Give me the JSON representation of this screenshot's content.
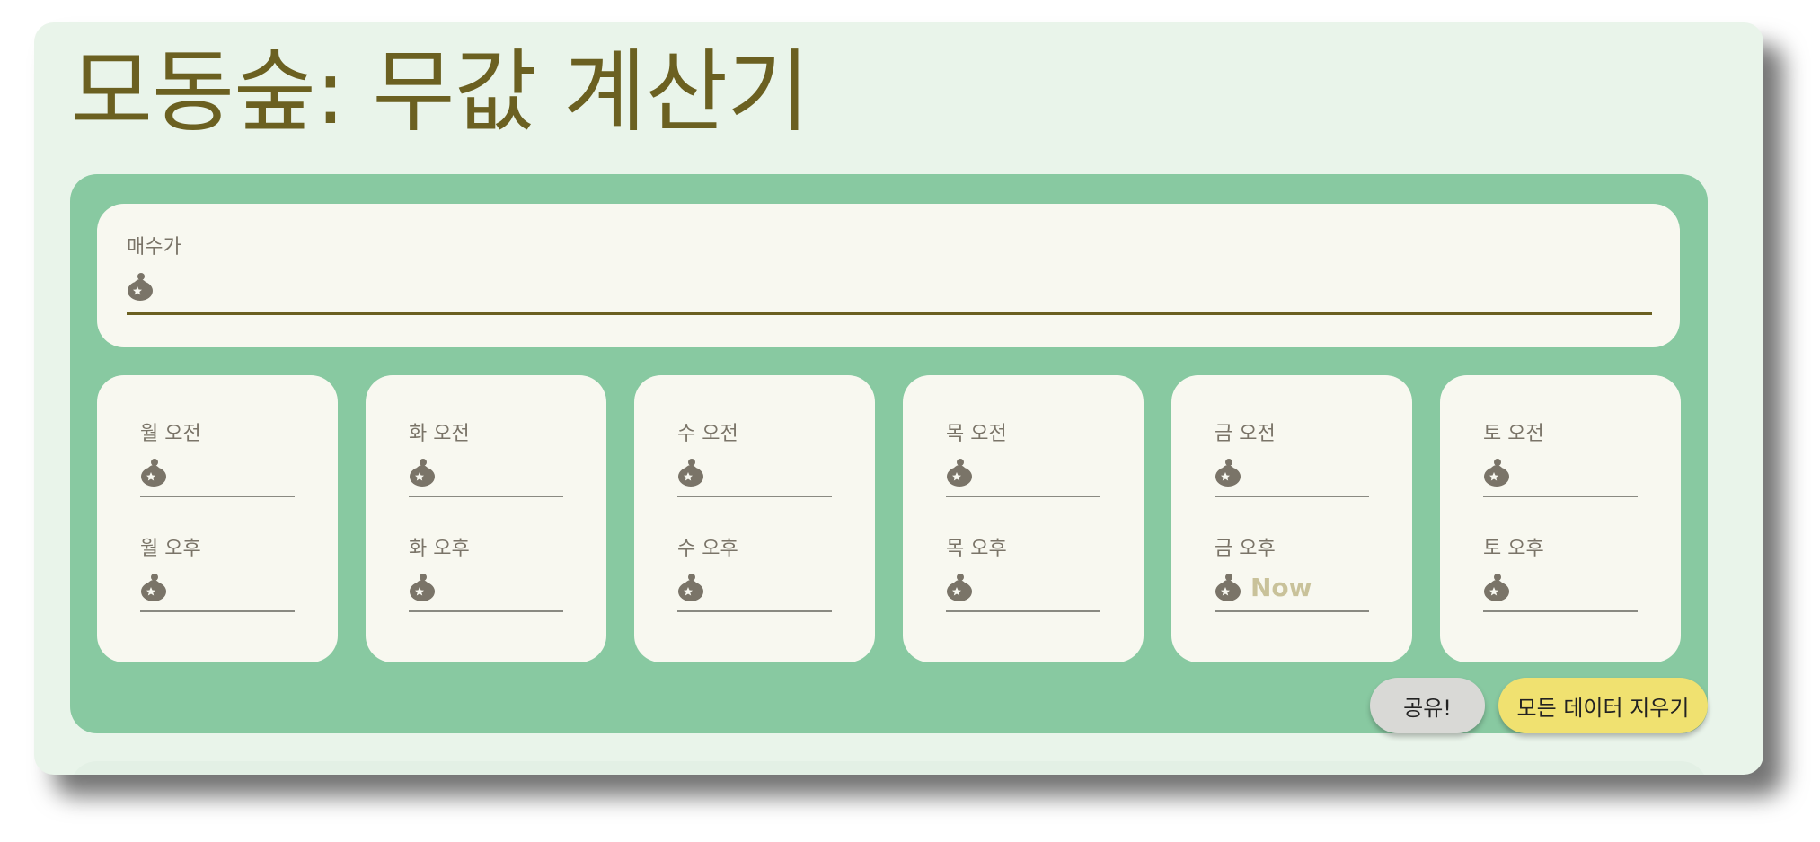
{
  "app": {
    "title": "모동숲: 무값 계산기"
  },
  "buy_price": {
    "label": "매수가",
    "value": "",
    "icon": "bell-bag-icon"
  },
  "days": [
    {
      "am_label": "월 오전",
      "am_placeholder": "",
      "pm_label": "월 오후",
      "pm_placeholder": ""
    },
    {
      "am_label": "화 오전",
      "am_placeholder": "",
      "pm_label": "화 오후",
      "pm_placeholder": ""
    },
    {
      "am_label": "수 오전",
      "am_placeholder": "",
      "pm_label": "수 오후",
      "pm_placeholder": ""
    },
    {
      "am_label": "목 오전",
      "am_placeholder": "",
      "pm_label": "목 오후",
      "pm_placeholder": ""
    },
    {
      "am_label": "금 오전",
      "am_placeholder": "",
      "pm_label": "금 오후",
      "pm_placeholder": "Now"
    },
    {
      "am_label": "토 오전",
      "am_placeholder": "",
      "pm_label": "토 오후",
      "pm_placeholder": ""
    }
  ],
  "actions": {
    "share_label": "공유!",
    "clear_label": "모든 데이터 지우기"
  },
  "colors": {
    "title": "#6b6021",
    "page_background": "#e9f4ea",
    "panel_green": "#88c9a1",
    "card_background": "#f8f8f0",
    "clear_button": "#f0e170",
    "share_button": "#d9d9d6",
    "placeholder": "#c9c29a"
  }
}
